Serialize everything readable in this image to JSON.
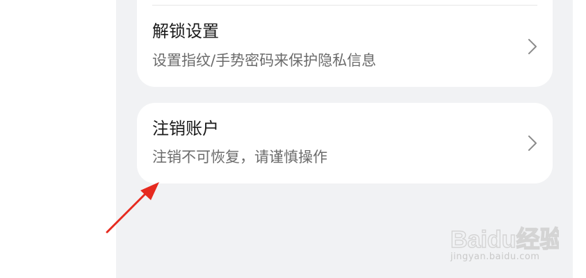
{
  "settings": {
    "items": [
      {
        "title": "解锁设置",
        "subtitle": "设置指纹/手势密码来保护隐私信息"
      },
      {
        "title": "注销账户",
        "subtitle": "注销不可恢复，请谨慎操作"
      }
    ]
  },
  "annotation": {
    "arrow_color": "#e62a1f"
  },
  "watermark": {
    "logo_text": "Baidu经验",
    "url": "jingyan.baidu.com"
  },
  "colors": {
    "background": "#f1f2f4",
    "card": "#ffffff",
    "title": "#1a1a1a",
    "subtitle": "#6b6b6b",
    "chevron": "#8a8a8a"
  }
}
